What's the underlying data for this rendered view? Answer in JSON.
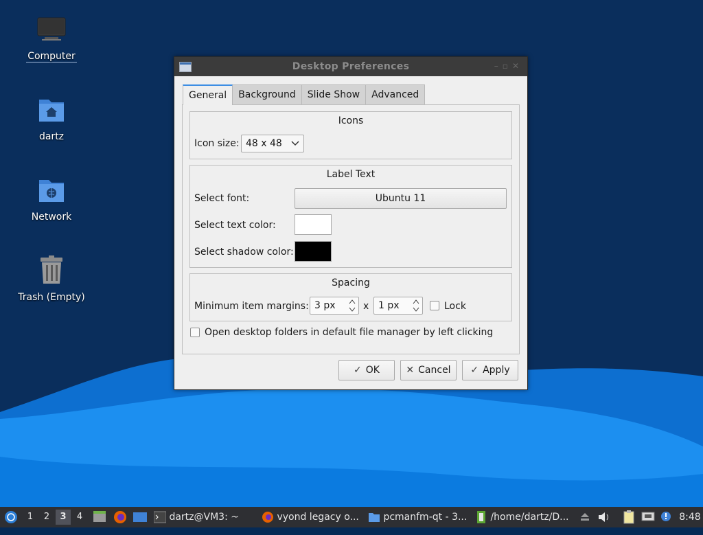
{
  "desktop": {
    "icons": [
      {
        "label": "Computer"
      },
      {
        "label": "dartz"
      },
      {
        "label": "Network"
      },
      {
        "label": "Trash (Empty)"
      }
    ]
  },
  "dialog": {
    "title": "Desktop Preferences",
    "tabs": [
      {
        "label": "General"
      },
      {
        "label": "Background"
      },
      {
        "label": "Slide Show"
      },
      {
        "label": "Advanced"
      }
    ],
    "icons_group": {
      "title": "Icons",
      "icon_size_label": "Icon size:",
      "icon_size_value": "48 x 48"
    },
    "label_text_group": {
      "title": "Label Text",
      "font_label": "Select font:",
      "font_value": "Ubuntu 11",
      "text_color_label": "Select text color:",
      "text_color": "#ffffff",
      "shadow_color_label": "Select shadow color:",
      "shadow_color": "#000000"
    },
    "spacing_group": {
      "title": "Spacing",
      "margins_label": "Minimum item margins:",
      "margin_x": "3 px",
      "separator": "x",
      "margin_y": "1 px",
      "lock_label": "Lock",
      "lock_checked": false
    },
    "open_folders_label": "Open desktop folders in default file manager by left clicking",
    "open_folders_checked": false,
    "buttons": {
      "ok": "OK",
      "cancel": "Cancel",
      "apply": "Apply"
    }
  },
  "taskbar": {
    "workspaces": [
      "1",
      "2",
      "3",
      "4"
    ],
    "active_workspace": "3",
    "tasks": [
      {
        "label": "dartz@VM3: ~",
        "icon": "terminal-icon"
      },
      {
        "label": "vyond legacy o...",
        "icon": "firefox-icon"
      },
      {
        "label": "pcmanfm-qt - 3...",
        "icon": "folder-icon"
      },
      {
        "label": "/home/dartz/D...",
        "icon": "text-editor-icon"
      }
    ],
    "clock": "8:48"
  },
  "colors": {
    "accent": "#3d8ee4",
    "desktop_bg": "#0a2e5c",
    "wave_light": "#1c8ff0",
    "wave_mid": "#0d6fd0",
    "taskbar_bg": "#2e2f33"
  }
}
